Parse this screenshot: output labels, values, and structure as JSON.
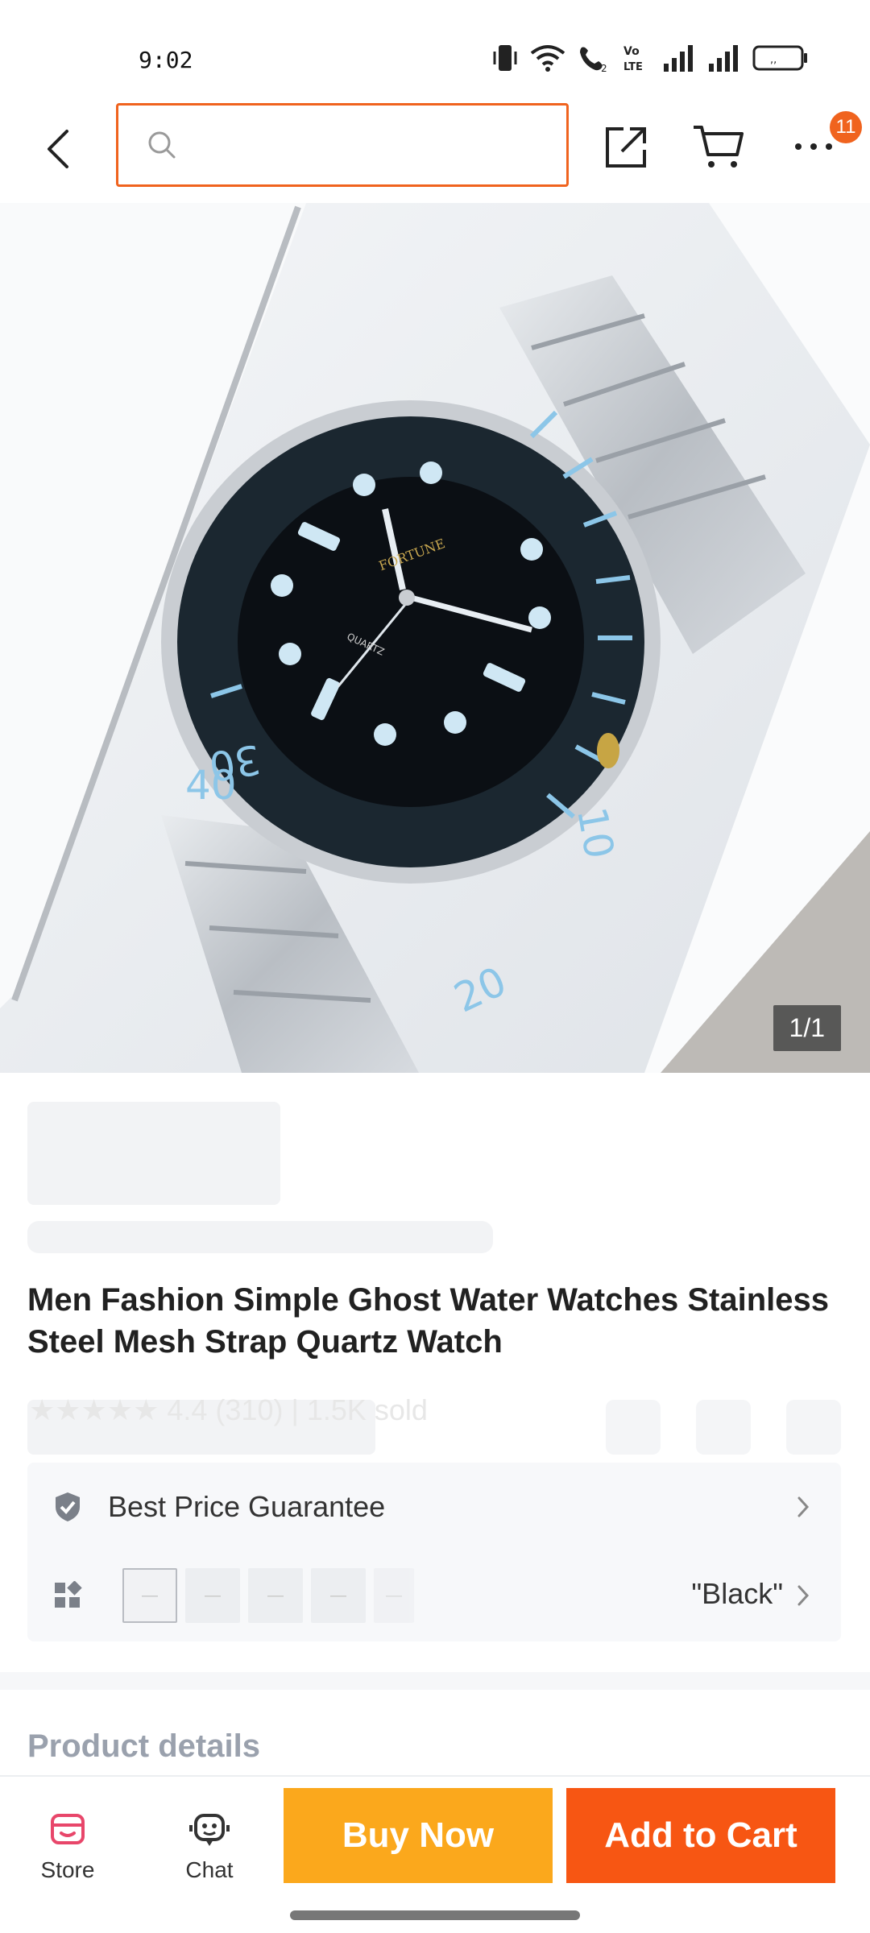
{
  "status_bar": {
    "time": "9:02",
    "icons": [
      "vibrate-icon",
      "wifi-icon",
      "volte-call-icon",
      "volte-lte-icon",
      "signal-icon",
      "signal-icon",
      "battery-icon"
    ],
    "volte_label": "Vo LTE"
  },
  "nav": {
    "search_placeholder": "",
    "cart_badge": "11",
    "icons": [
      "back-icon",
      "search-icon",
      "share-icon",
      "cart-icon",
      "more-icon"
    ]
  },
  "gallery": {
    "counter": "1/1",
    "image_alt": "Silver stainless steel watch with black dial and blue bezel"
  },
  "product": {
    "title": "Men Fashion Simple Ghost Water Watches Stainless Steel Mesh Strap Quartz Watch",
    "ghost_rating": "★★★★★  4.4 (310)  |  1.5K sold"
  },
  "info": {
    "guarantee_label": "Best Price Guarantee",
    "variant_value": "\"Black\"",
    "variant_thumbs": [
      "—",
      "—",
      "—",
      "—",
      "—"
    ]
  },
  "sections": {
    "product_details": "Product details"
  },
  "bottom_bar": {
    "store_label": "Store",
    "chat_label": "Chat",
    "buy_now": "Buy Now",
    "add_to_cart": "Add to Cart"
  },
  "colors": {
    "accent": "#f0631e",
    "buy_now": "#fba81c",
    "add_to_cart": "#f75613",
    "store_icon": "#e8466a"
  }
}
